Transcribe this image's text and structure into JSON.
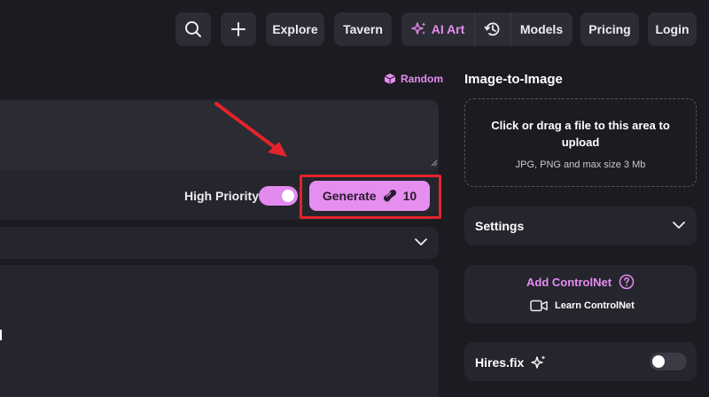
{
  "nav": {
    "explore": "Explore",
    "tavern": "Tavern",
    "ai_art": "AI Art",
    "models": "Models",
    "pricing": "Pricing",
    "login": "Login"
  },
  "prompt": {
    "random": "Random",
    "high_priority": "High Priority",
    "generate_label": "Generate",
    "generate_cost": "10"
  },
  "image_to_image": {
    "title": "Image-to-Image",
    "drop_main": "Click or drag a file to this area to upload",
    "drop_sub": "JPG, PNG and max size 3 Mb"
  },
  "settings": {
    "label": "Settings"
  },
  "controlnet": {
    "add": "Add ControlNet",
    "learn": "Learn ControlNet"
  },
  "hires": {
    "label": "Hires.fix",
    "enabled": false
  },
  "colors": {
    "accent": "#e68ef0",
    "background": "#1b1b21",
    "panel": "#25262d",
    "highlight": "#e4232b"
  }
}
